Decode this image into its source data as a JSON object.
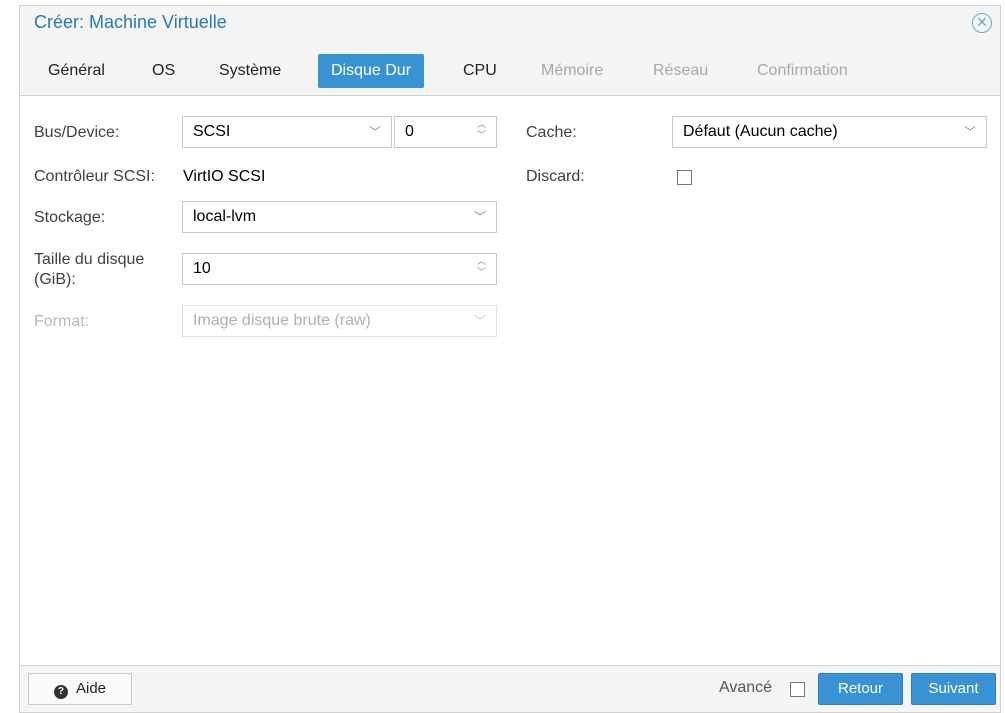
{
  "dialog": {
    "title": "Créer: Machine Virtuelle"
  },
  "tabs": [
    {
      "label": "Général",
      "state": "normal"
    },
    {
      "label": "OS",
      "state": "normal"
    },
    {
      "label": "Système",
      "state": "normal"
    },
    {
      "label": "Disque Dur",
      "state": "active"
    },
    {
      "label": "CPU",
      "state": "normal"
    },
    {
      "label": "Mémoire",
      "state": "disabled"
    },
    {
      "label": "Réseau",
      "state": "disabled"
    },
    {
      "label": "Confirmation",
      "state": "disabled"
    }
  ],
  "form": {
    "bus_device": {
      "label": "Bus/Device:",
      "bus_value": "SCSI",
      "device_value": "0"
    },
    "controller": {
      "label": "Contrôleur SCSI:",
      "value": "VirtIO SCSI"
    },
    "storage": {
      "label": "Stockage:",
      "value": "local-lvm"
    },
    "disk_size": {
      "label_line1": "Taille du disque",
      "label_line2": "(GiB):",
      "value": "10"
    },
    "format": {
      "label": "Format:",
      "value": "Image disque brute (raw)"
    },
    "cache": {
      "label": "Cache:",
      "value": "Défaut (Aucun cache)"
    },
    "discard": {
      "label": "Discard:",
      "checked": false
    }
  },
  "footer": {
    "help_label": "Aide",
    "advanced_label": "Avancé",
    "back_label": "Retour",
    "next_label": "Suivant"
  },
  "colors": {
    "accent": "#3892d4",
    "title": "#2779b8",
    "disabled": "#a8a8a8"
  },
  "icons": {
    "close": "close-circle-icon",
    "help": "question-circle-icon",
    "dropdown": "chevron-down-icon",
    "spinner": "spinner-arrows-icon"
  }
}
